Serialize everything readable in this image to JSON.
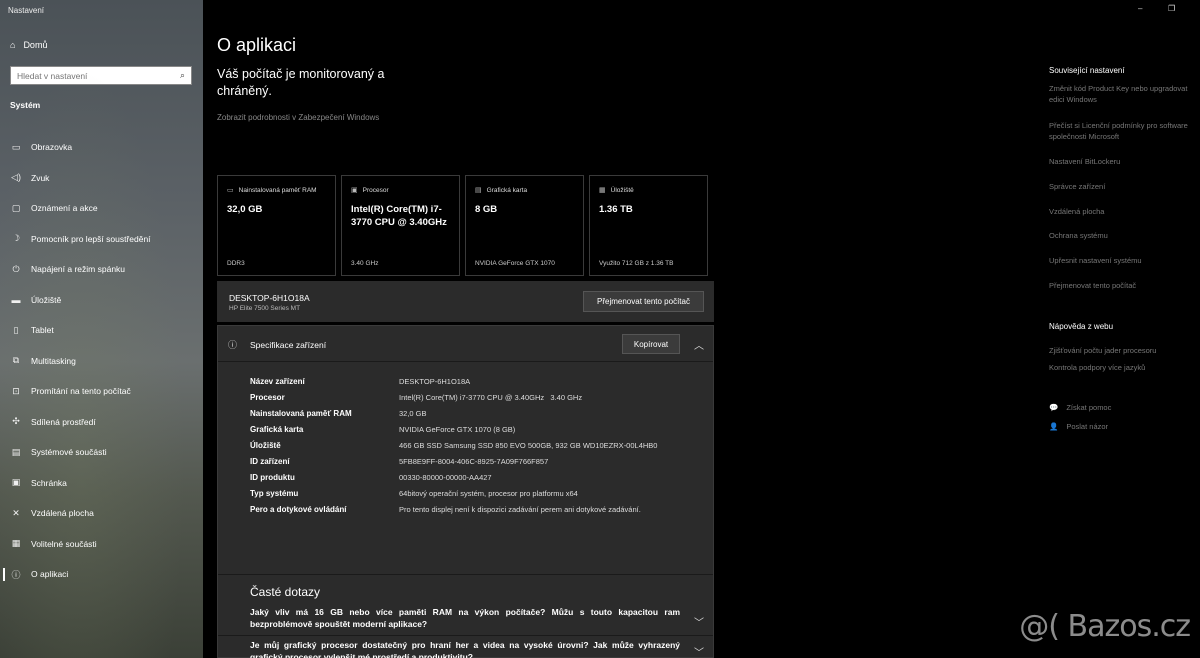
{
  "window": {
    "title": "Nastavení",
    "minimize": "–",
    "maximize": "❐"
  },
  "sidebar": {
    "home_label": "Domů",
    "search_placeholder": "Hledat v nastavení",
    "section": "Systém",
    "items": [
      {
        "label": "Obrazovka",
        "icon": "monitor-icon"
      },
      {
        "label": "Zvuk",
        "icon": "speaker-icon"
      },
      {
        "label": "Oznámení a akce",
        "icon": "notification-icon"
      },
      {
        "label": "Pomocník pro lepší soustředění",
        "icon": "moon-icon"
      },
      {
        "label": "Napájení a režim spánku",
        "icon": "power-icon"
      },
      {
        "label": "Úložiště",
        "icon": "storage-icon"
      },
      {
        "label": "Tablet",
        "icon": "tablet-icon"
      },
      {
        "label": "Multitasking",
        "icon": "multitasking-icon"
      },
      {
        "label": "Promítání na tento počítač",
        "icon": "projector-icon"
      },
      {
        "label": "Sdílená prostředí",
        "icon": "shared-icon"
      },
      {
        "label": "Systémové součásti",
        "icon": "components-icon"
      },
      {
        "label": "Schránka",
        "icon": "clipboard-icon"
      },
      {
        "label": "Vzdálená plocha",
        "icon": "remote-icon"
      },
      {
        "label": "Volitelné součásti",
        "icon": "optional-icon"
      },
      {
        "label": "O aplikaci",
        "icon": "info-icon"
      }
    ]
  },
  "main": {
    "title": "O aplikaci",
    "protected_text": "Váš počítač je monitorovaný a chráněný.",
    "security_link": "Zobrazit podrobnosti v Zabezpečení Windows",
    "cards": [
      {
        "label": "Nainstalovaná paměť RAM",
        "value": "32,0 GB",
        "sub": "DDR3",
        "icon": "ram-icon"
      },
      {
        "label": "Procesor",
        "value": "Intel(R) Core(TM) i7-3770 CPU @ 3.40GHz",
        "sub": "3.40 GHz",
        "icon": "cpu-icon"
      },
      {
        "label": "Grafická karta",
        "value": "8 GB",
        "sub": "NVIDIA GeForce GTX 1070",
        "icon": "gpu-icon"
      },
      {
        "label": "Úložiště",
        "value": "1.36 TB",
        "sub": "Využito 712 GB z 1.36 TB",
        "icon": "disk-icon"
      }
    ],
    "device": {
      "name": "DESKTOP-6H1O18A",
      "model": "HP Elite 7500 Series MT",
      "rename_label": "Přejmenovat tento počítač"
    },
    "spec": {
      "title": "Specifikace zařízení",
      "copy_label": "Kopírovat",
      "rows": [
        {
          "k": "Název zařízení",
          "v": "DESKTOP-6H1O18A"
        },
        {
          "k": "Procesor",
          "v": "Intel(R) Core(TM) i7-3770 CPU @ 3.40GHz   3.40 GHz"
        },
        {
          "k": "Nainstalovaná paměť RAM",
          "v": "32,0 GB"
        },
        {
          "k": "Grafická karta",
          "v": "NVIDIA GeForce GTX 1070 (8 GB)"
        },
        {
          "k": "Úložiště",
          "v": "466 GB SSD Samsung SSD 850 EVO 500GB, 932 GB WD10EZRX-00L4HB0"
        },
        {
          "k": "ID zařízení",
          "v": "5FB8E9FF-8004-406C-8925-7A09F766F857"
        },
        {
          "k": "ID produktu",
          "v": "00330-80000-00000-AA427"
        },
        {
          "k": "Typ systému",
          "v": "64bitový operační systém, procesor pro platformu x64"
        },
        {
          "k": "Pero a dotykové ovládání",
          "v": "Pro tento displej není k dispozici zadávání perem ani dotykové zadávání."
        }
      ]
    },
    "faq": {
      "title": "Časté dotazy",
      "items": [
        "Jaký vliv má 16 GB nebo více paměti RAM na výkon počítače? Můžu s touto kapacitou ram bezproblémově spouštět moderní aplikace?",
        "Je můj grafický procesor dostatečný pro hraní her a videa na vysoké úrovni? Jak může vyhrazený grafický procesor vylepšit mé prostředí a produktivitu?"
      ]
    }
  },
  "right": {
    "related_title": "Související nastavení",
    "related_links": [
      "Změnit kód Product Key nebo upgradovat edici Windows",
      "Přečíst si Licenční podmínky pro software společnosti Microsoft",
      "Nastavení BitLockeru",
      "Správce zařízení",
      "Vzdálená plocha",
      "Ochrana systému",
      "Upřesnit nastavení systému",
      "Přejmenovat tento počítač"
    ],
    "web_help_title": "Nápověda z webu",
    "web_help_links": [
      "Zjišťování počtu jader procesoru",
      "Kontrola podpory více jazyků"
    ],
    "get_help": "Získat pomoc",
    "feedback": "Poslat názor"
  },
  "watermark": "@( Bazos.cz"
}
